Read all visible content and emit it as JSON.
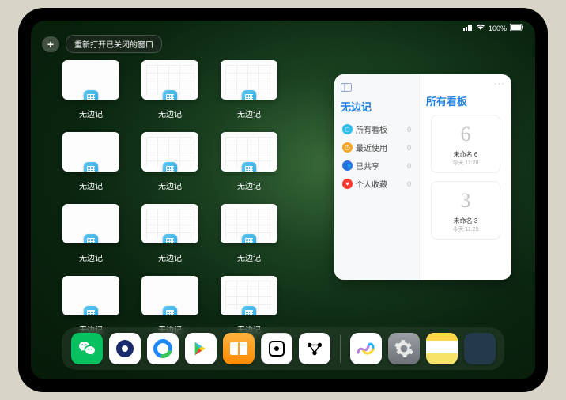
{
  "status": {
    "pct": "100%"
  },
  "top": {
    "add": "+",
    "reopen_label": "重新打开已关闭的窗口"
  },
  "thumb_label": "无边记",
  "sidebar": {
    "title": "无边记",
    "items": [
      {
        "label": "所有看板",
        "count": "0",
        "color": "#2dbef0",
        "glyph": "◻"
      },
      {
        "label": "最近使用",
        "count": "0",
        "color": "#f6a623",
        "glyph": "◷"
      },
      {
        "label": "已共享",
        "count": "0",
        "color": "#2f6fe0",
        "glyph": "👥"
      },
      {
        "label": "个人收藏",
        "count": "0",
        "color": "#ff3b30",
        "glyph": "♥"
      }
    ],
    "right_title": "所有看板",
    "boards": [
      {
        "glyph": "6",
        "name": "未命名 6",
        "time": "今天 11:28"
      },
      {
        "glyph": "3",
        "name": "未命名 3",
        "time": "今天 11:25"
      }
    ],
    "more": "···"
  },
  "dock": {
    "icons": [
      {
        "name": "wechat-icon"
      },
      {
        "name": "hd-browser-icon"
      },
      {
        "name": "quark-icon"
      },
      {
        "name": "play-icon"
      },
      {
        "name": "books-icon"
      },
      {
        "name": "dice-icon"
      },
      {
        "name": "node-icon"
      }
    ],
    "icons_right": [
      {
        "name": "freeform-icon"
      },
      {
        "name": "settings-icon"
      },
      {
        "name": "notes-icon"
      },
      {
        "name": "app-library-icon"
      }
    ]
  }
}
